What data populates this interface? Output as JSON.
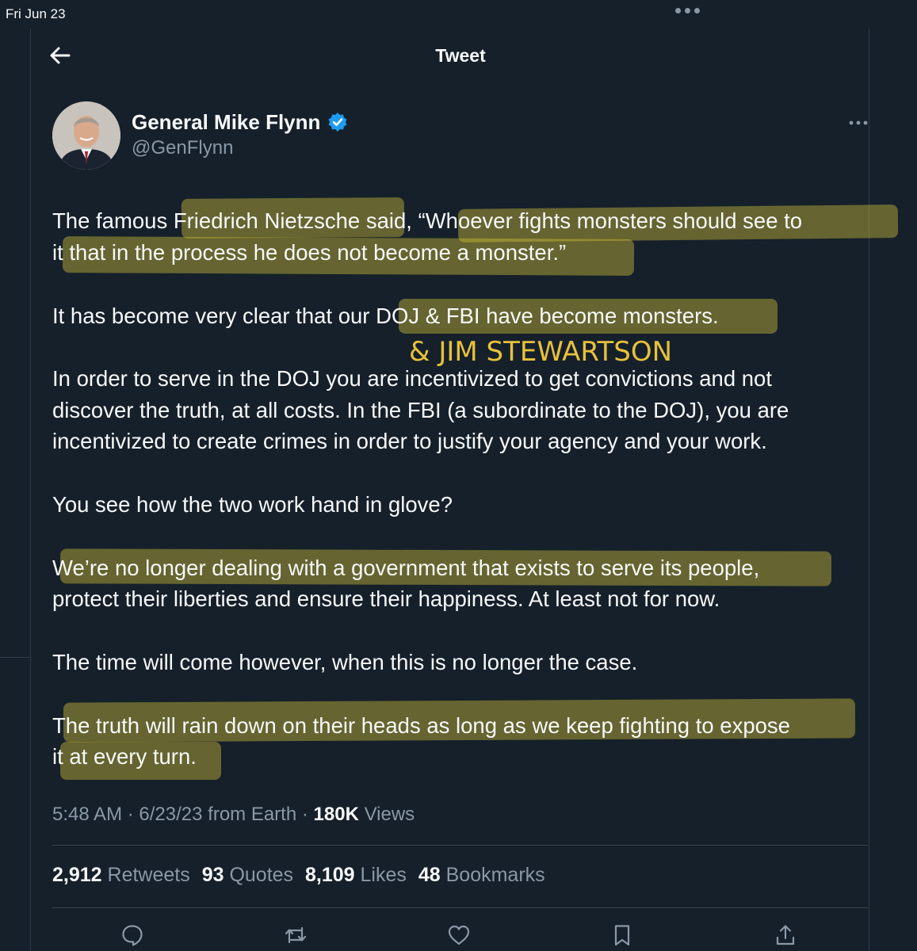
{
  "status_bar": {
    "date": "Fri Jun 23"
  },
  "header": {
    "title": "Tweet"
  },
  "author": {
    "name": "General Mike Flynn",
    "handle": "@GenFlynn"
  },
  "tweet_lines": [
    [
      "The famous Friedrich Nietzsche said, “Whoever fights monsters should see to"
    ],
    [
      "it that in the process he does not become a monster.”"
    ],
    [
      "It has become very clear that our DOJ & FBI have become monsters."
    ],
    [
      "In order to serve in the DOJ you are incentivized to get convictions and not"
    ],
    [
      "discover the truth, at all costs. In the FBI (a subordinate to the DOJ), you are"
    ],
    [
      "incentivized to create crimes in order to justify your agency and your work."
    ],
    [
      "You see how the two work hand in glove?"
    ],
    [
      "We’re no longer dealing with a government that exists to serve its people,"
    ],
    [
      "protect their liberties and ensure their happiness. At least not for now."
    ],
    [
      "The time will come however, when this is no longer the case."
    ],
    [
      "The truth will rain down on their heads as long as we keep fighting to expose"
    ],
    [
      "it at every turn."
    ]
  ],
  "annotation": "& JIM STEWARTSON",
  "meta": {
    "time": "5:48 AM",
    "date": "6/23/23",
    "source": "from Earth",
    "views_count": "180K",
    "views_label": "Views"
  },
  "stats": {
    "retweets_count": "2,912",
    "retweets_label": "Retweets",
    "quotes_count": "93",
    "quotes_label": "Quotes",
    "likes_count": "8,109",
    "likes_label": "Likes",
    "bookmarks_count": "48",
    "bookmarks_label": "Bookmarks"
  },
  "icons": [
    "back-arrow-icon",
    "verified-badge-icon",
    "more-options-icon",
    "reply-icon",
    "retweet-icon",
    "like-icon",
    "bookmark-icon",
    "share-icon"
  ],
  "colors": {
    "background": "#15202b",
    "text": "#f7f9f9",
    "secondary": "#8b98a5",
    "verified": "#1d9bf0",
    "highlight": "#d6c438",
    "annotation": "#e8c13a"
  }
}
